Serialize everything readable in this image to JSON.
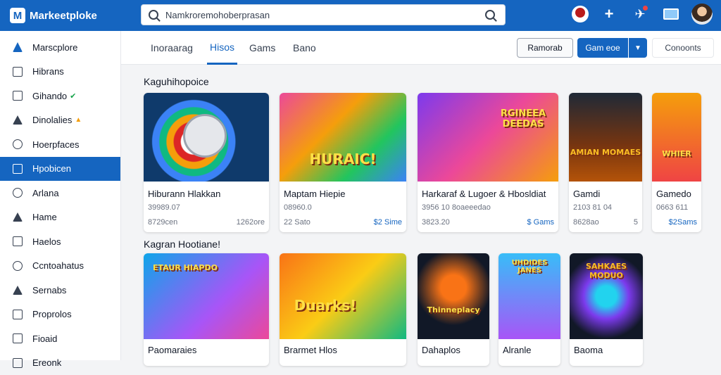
{
  "app": {
    "logo_letter": "M",
    "title": "Markeetploke"
  },
  "search": {
    "value": "Namkroremohoberprasan"
  },
  "tabs": [
    "Inoraarag",
    "Hisos",
    "Gams",
    "Bano"
  ],
  "toolbar": {
    "btn1": "Ramorab",
    "btn2": "Gam eoe",
    "btn3": "Conoonts"
  },
  "sidebar": {
    "items": [
      {
        "label": "Marscplore"
      },
      {
        "label": "Hibrans"
      },
      {
        "label": "Gihando"
      },
      {
        "label": "Dinolalies"
      },
      {
        "label": "Hoerpfaces"
      },
      {
        "label": "Hpobicen"
      },
      {
        "label": "Arlana"
      },
      {
        "label": "Hame"
      },
      {
        "label": "Haelos"
      },
      {
        "label": "Ccntoahatus"
      },
      {
        "label": "Sernabs"
      },
      {
        "label": "Proprolos"
      },
      {
        "label": "Fioaid"
      },
      {
        "label": "Ereonk"
      }
    ]
  },
  "section1": {
    "title": "Kaguhihopoice",
    "cards": [
      {
        "art": "",
        "title": "Hiburann Hlakkan",
        "sub": "39989.07",
        "price": "8729cen",
        "right": "1262ore"
      },
      {
        "art": "HURAIC!",
        "title": "Maptam Hiepie",
        "sub": "08960.0",
        "price": "22 Sato",
        "right": "$2 Sime"
      },
      {
        "art": "RGINEEA DEEDAS",
        "title": "Harkaraf & Lugoer & Hbosldiat",
        "sub": "3956 10 8oaeeedao",
        "price": "3823.20",
        "right": "$ Gams"
      },
      {
        "art": "AMIAN MOMAES",
        "title": "Gamdi",
        "sub": "2103 81 04",
        "price": "8628ao",
        "right": "5"
      },
      {
        "art": "WHIER",
        "title": "Gamedo",
        "sub": "0663 611",
        "price": "",
        "right": "$2Sams"
      }
    ]
  },
  "section2": {
    "title": "Kagran Hootiane!",
    "cards": [
      {
        "art": "ETAUR HIAPDO",
        "title": "Paomaraies"
      },
      {
        "art": "Duarks!",
        "title": "Brarmet Hlos"
      },
      {
        "art": "Thinneplacy",
        "title": "Dahaplos"
      },
      {
        "art": "UHDIDES JANES",
        "title": "Alranle"
      },
      {
        "art": "SAHKAES MODUO",
        "title": "Baoma"
      }
    ]
  },
  "colors": {
    "primary": "#1565c0",
    "active_tab": "#1565c0"
  }
}
